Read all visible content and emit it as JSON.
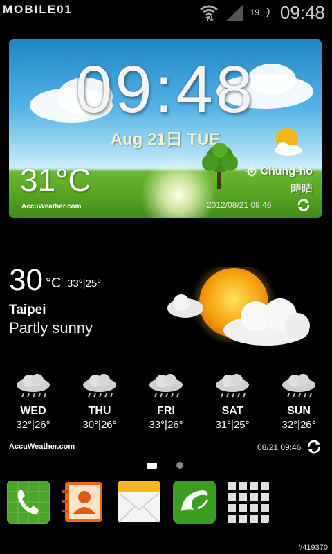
{
  "status_bar": {
    "watermark": "MOBILE01",
    "network_badge": "19",
    "time": "09:48"
  },
  "clock_widget": {
    "time": "09:48",
    "date": "Aug 21日 TUE",
    "temperature": "31°C",
    "location": "Chung-ho",
    "condition": "時晴",
    "brand": "AccuWeather.com",
    "updated": "2012/08/21 09:46"
  },
  "weather_widget": {
    "temperature": "30",
    "unit": "°C",
    "hi_lo": "33°|25°",
    "city": "Taipei",
    "condition": "Partly sunny",
    "forecast": [
      {
        "day": "WED",
        "temps": "32°|26°"
      },
      {
        "day": "THU",
        "temps": "30°|26°"
      },
      {
        "day": "FRI",
        "temps": "33°|26°"
      },
      {
        "day": "SAT",
        "temps": "31°|25°"
      },
      {
        "day": "SUN",
        "temps": "32°|26°"
      }
    ],
    "brand": "AccuWeather.com",
    "updated": "08/21 09:46"
  },
  "pager": {
    "pages": 2,
    "active": 1
  },
  "dock": {
    "apps": [
      "phone-icon",
      "contacts-icon",
      "messages-icon",
      "dolphin-browser-icon",
      "apps-grid-icon"
    ]
  },
  "footer": {
    "image_id": "#419370"
  }
}
